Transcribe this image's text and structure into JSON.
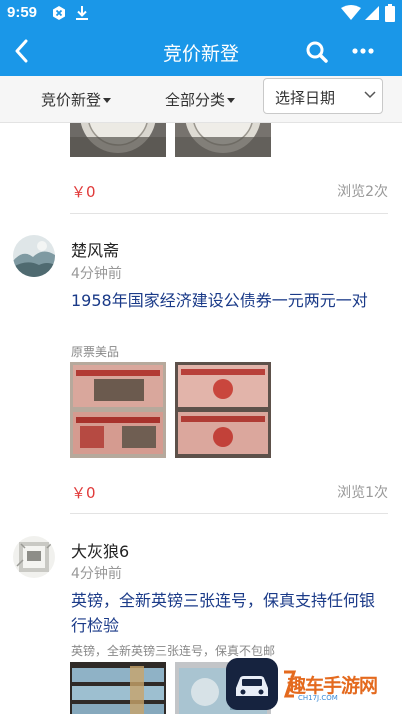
{
  "status_bar": {
    "time": "9:59",
    "icons": [
      "hex-app-icon",
      "download-icon",
      "wifi-icon",
      "cell-signal-icon",
      "battery-icon"
    ]
  },
  "nav": {
    "title": "竞价新登",
    "icons": [
      "back-arrow-icon",
      "search-icon",
      "more-icon"
    ]
  },
  "filters": {
    "listing": "竞价新登",
    "category": "全部分类",
    "date_placeholder": "选择日期"
  },
  "colors": {
    "primary": "#1a97e8",
    "price": "#e03a3a",
    "title": "#1a3a88",
    "muted": "#999999"
  },
  "posts": [
    {
      "price": "￥0",
      "views": "浏览2次",
      "image_icons": [
        "coin-photo",
        "coin-photo"
      ]
    },
    {
      "user": "楚风斋",
      "time": "4分钟前",
      "title": "1958年国家经济建设公债券一元两元一对",
      "desc": "原票美品",
      "price": "￥0",
      "views": "浏览1次",
      "image_icons": [
        "bond-photo",
        "bond-photo"
      ]
    },
    {
      "user": "大灰狼6",
      "time": "4分钟前",
      "title": "英镑，全新英镑三张连号，保真支持任何银行检验",
      "desc": "英镑，全新英镑三张连号，保真不包邮",
      "image_icons": [
        "banknote-photo",
        "banknote-photo"
      ]
    }
  ],
  "watermark": {
    "text": "趣车手游网",
    "sub": "CH17J.COM"
  }
}
